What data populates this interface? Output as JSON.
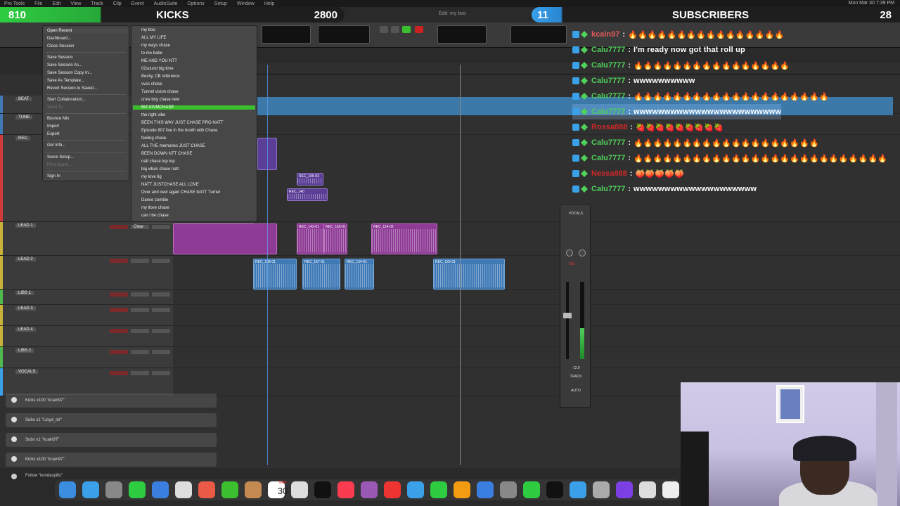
{
  "menubar": {
    "items": [
      "Pro Tools",
      "File",
      "Edit",
      "View",
      "Track",
      "Clip",
      "Event",
      "AudioSuite",
      "Options",
      "Setup",
      "Window",
      "Help"
    ],
    "clock": "Mon Mar 30  7:39 PM"
  },
  "stream": {
    "kicks_count": "810",
    "kicks_label": "KICKS",
    "kicks_goal": "2800",
    "subs_count": "11",
    "subs_label": "SUBSCRIBERS",
    "subs_goal": "28",
    "colors": {
      "kicks": "#2ecc40",
      "subs": "#3aa0e8"
    }
  },
  "protools": {
    "edit_window_title": "Edit: my boo",
    "file_menu": [
      {
        "label": "Open Recent",
        "state": "active"
      },
      {
        "label": "Dashboard...",
        "state": "normal"
      },
      {
        "label": "Close Session",
        "state": "normal"
      },
      {
        "label": "Save Session",
        "state": "normal"
      },
      {
        "label": "Save Session As...",
        "state": "normal"
      },
      {
        "label": "Save Session Copy In...",
        "state": "normal"
      },
      {
        "label": "Save As Template...",
        "state": "normal"
      },
      {
        "label": "Revert Session to Saved...",
        "state": "normal"
      },
      {
        "label": "Start Collaboration...",
        "state": "normal"
      },
      {
        "label": "Send To",
        "state": "dim"
      },
      {
        "label": "Bounce Mix",
        "state": "normal"
      },
      {
        "label": "Import",
        "state": "normal"
      },
      {
        "label": "Export",
        "state": "normal"
      },
      {
        "label": "Get Info...",
        "state": "normal"
      },
      {
        "label": "Score Setup...",
        "state": "normal"
      },
      {
        "label": "Print Score...",
        "state": "dim"
      },
      {
        "label": "Sign In",
        "state": "normal"
      }
    ],
    "recent_sessions": [
      "my boo",
      "ALL MY LIFE",
      "my ways chase",
      "to me babe",
      "ME AND YOU  NTT",
      "02sound big time",
      "Becky, CB reference",
      "vvss chase",
      "Tunnel vision chase",
      "crow boy chase new",
      "BIZ KIVMCHASE",
      "the right vibe",
      "BEEN THIS WAY JUST CHASE  PRO NATT",
      "Episode 807 live in the booth with Chase",
      "feeling chase",
      "ALL THE memories JUST CHASE",
      "BEEN DOWN NTT CHASE",
      "natt chase top top",
      "big vibes chase natt",
      "my love tig",
      "NATT JUSTCHASE ALL LOVE",
      "Over and over again CHASE NATT Turner",
      "Dance zombie",
      "my llove chase",
      "can i be chase"
    ],
    "recent_highlighted_index": 10,
    "recent_clear_label": "Clear",
    "tracks": [
      {
        "name": "BEAT",
        "color": "#3f79b6"
      },
      {
        "name": "TUNE",
        "color": "#3f79b6"
      },
      {
        "name": "REC",
        "color": "#d23a3a"
      },
      {
        "name": "LEAD 1",
        "color": "#c9b23a"
      },
      {
        "name": "LEAD 2",
        "color": "#c9b23a"
      },
      {
        "name": "LIBS 1",
        "color": "#4fb84f"
      },
      {
        "name": "LEAD 3",
        "color": "#c9b23a"
      },
      {
        "name": "LEAD 4",
        "color": "#c9b23a"
      },
      {
        "name": "LIBS 2",
        "color": "#4fb84f"
      },
      {
        "name": "VOCALS",
        "color": "#3aa0e8"
      }
    ],
    "clips": [
      {
        "label": "REC_106-03",
        "kind": "violet"
      },
      {
        "label": "REC_140",
        "kind": "violet"
      },
      {
        "label": "REC_143-01",
        "kind": "purple"
      },
      {
        "label": "REC_155-01",
        "kind": "purple"
      },
      {
        "label": "REC_114-02",
        "kind": "purple"
      },
      {
        "label": "REC_138-01",
        "kind": "blue"
      },
      {
        "label": "REC_167-01",
        "kind": "blue"
      },
      {
        "label": "REC_134-01",
        "kind": "blue"
      },
      {
        "label": "REC_120-01",
        "kind": "blue"
      }
    ],
    "mixer": {
      "track_label": "VOCALS",
      "volume": "-100",
      "level": "-12.9",
      "automation": "TRACK",
      "automation_mode": "AUTO",
      "meter_level": 0.4
    }
  },
  "chat": [
    {
      "user": "kcain97",
      "user_color": "#e05a5a",
      "message": "🔥🔥🔥🔥🔥🔥🔥🔥🔥🔥🔥🔥🔥🔥🔥🔥"
    },
    {
      "user": "Calu7777",
      "user_color": "#4fd15a",
      "message": "I'm ready now got that roll up"
    },
    {
      "user": "Calu7777",
      "user_color": "#4fd15a",
      "message": "🔥🔥🔥🔥🔥🔥🔥🔥🔥🔥🔥🔥🔥🔥🔥🔥"
    },
    {
      "user": "Calu7777",
      "user_color": "#4fd15a",
      "message": "wwwwwwwwww"
    },
    {
      "user": "Calu7777",
      "user_color": "#4fd15a",
      "message": "🔥🔥🔥🔥🔥🔥🔥🔥🔥🔥🔥🔥🔥🔥🔥🔥🔥🔥🔥🔥"
    },
    {
      "user": "Calu7777",
      "user_color": "#4fd15a",
      "message": "wwwwwwwwwwwwwwwwwwwwwwww"
    },
    {
      "user": "Rossa888",
      "user_color": "#d0282a",
      "message": "🍓🍓🍓🍓🍓🍓🍓🍓🍓"
    },
    {
      "user": "Calu7777",
      "user_color": "#4fd15a",
      "message": "🔥🔥🔥🔥🔥🔥🔥🔥🔥🔥🔥🔥🔥🔥🔥🔥🔥🔥🔥"
    },
    {
      "user": "Calu7777",
      "user_color": "#4fd15a",
      "message": "🔥🔥🔥🔥🔥🔥🔥🔥🔥🔥🔥🔥🔥🔥🔥🔥🔥🔥🔥🔥🔥🔥🔥🔥🔥🔥"
    },
    {
      "user": "Nessa888",
      "user_color": "#d0282a",
      "message": "🍑🍑🍑🍑🍑"
    },
    {
      "user": "Calu7777",
      "user_color": "#4fd15a",
      "message": "wwwwwwwwwwwwwwwwwwww"
    }
  ],
  "chat_highlight_index": 5,
  "alerts": [
    {
      "text": "Kicks x100 \"kcain97\""
    },
    {
      "text": "Subs x1 \"Lloyd_str\""
    },
    {
      "text": "Subs x1 \"kcain97\""
    },
    {
      "text": "Kicks x100 \"kcain97\""
    }
  ],
  "follow_alert": "Follow \"kondaspills\"",
  "dock": {
    "calendar_month": "MAR",
    "calendar_day": "30",
    "app_count": 27
  }
}
